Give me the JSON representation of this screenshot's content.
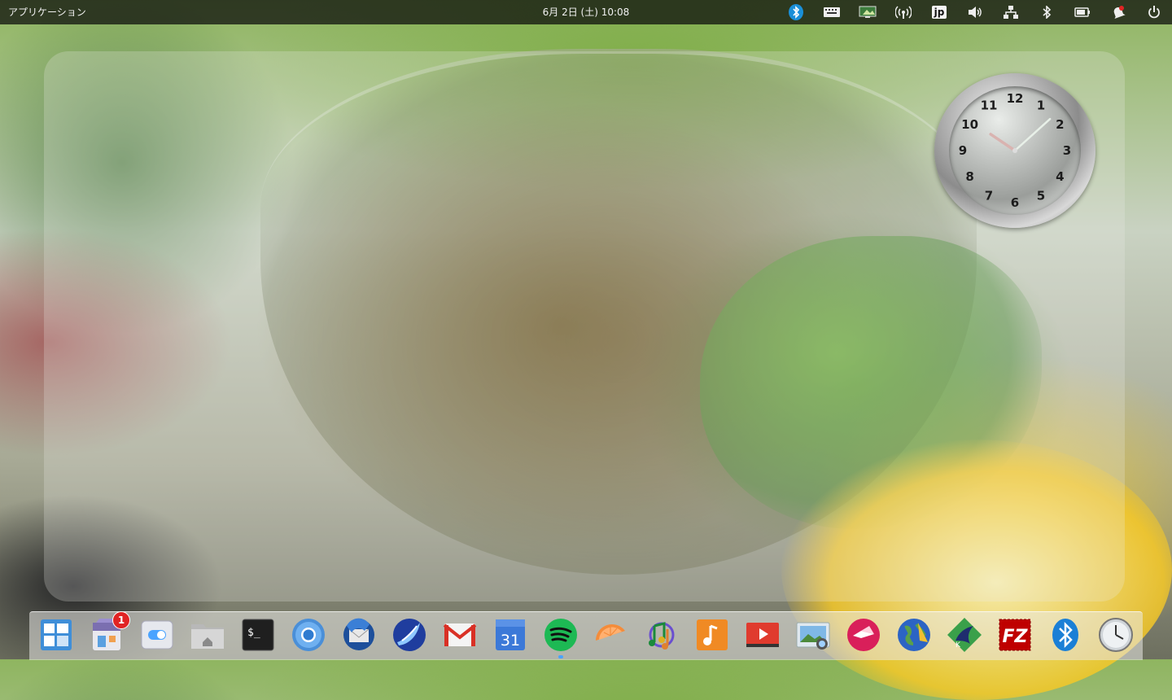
{
  "top_panel": {
    "applications_label": "アプリケーション",
    "datetime": "6月 2日 (土)   10:08",
    "indicators": [
      {
        "name": "bluetooth-app-icon"
      },
      {
        "name": "keyboard-icon"
      },
      {
        "name": "display-icon"
      },
      {
        "name": "wireless-icon"
      },
      {
        "name": "input-method-jp-icon",
        "label": "jp"
      },
      {
        "name": "volume-icon"
      },
      {
        "name": "network-icon"
      },
      {
        "name": "bluetooth-icon"
      },
      {
        "name": "battery-icon"
      },
      {
        "name": "notification-icon"
      },
      {
        "name": "power-icon"
      }
    ]
  },
  "clock_widget": {
    "numerals": [
      "12",
      "1",
      "2",
      "3",
      "4",
      "5",
      "6",
      "7",
      "8",
      "9",
      "10",
      "11"
    ],
    "time": "10:08"
  },
  "dock": {
    "items": [
      {
        "name": "multitasking-view-icon"
      },
      {
        "name": "app-store-icon",
        "badge": "1"
      },
      {
        "name": "system-settings-icon"
      },
      {
        "name": "files-icon"
      },
      {
        "name": "terminal-icon",
        "glyph": "$_"
      },
      {
        "name": "chromium-icon"
      },
      {
        "name": "thunderbird-icon"
      },
      {
        "name": "web-browser-icon"
      },
      {
        "name": "gmail-icon"
      },
      {
        "name": "calendar-icon",
        "day": "31"
      },
      {
        "name": "spotify-icon"
      },
      {
        "name": "orange-slice-icon"
      },
      {
        "name": "music-player-icon"
      },
      {
        "name": "music-icon"
      },
      {
        "name": "video-player-icon"
      },
      {
        "name": "photos-icon"
      },
      {
        "name": "bird-app-icon"
      },
      {
        "name": "globe-icon"
      },
      {
        "name": "krita-icon"
      },
      {
        "name": "filezilla-icon",
        "label": "FZ"
      },
      {
        "name": "bluetooth-dock-icon"
      },
      {
        "name": "clock-app-icon"
      }
    ]
  },
  "colors": {
    "panel_bg": "#0a0a0a",
    "badge_red": "#e02424",
    "accent_blue": "#4aa3ff"
  }
}
